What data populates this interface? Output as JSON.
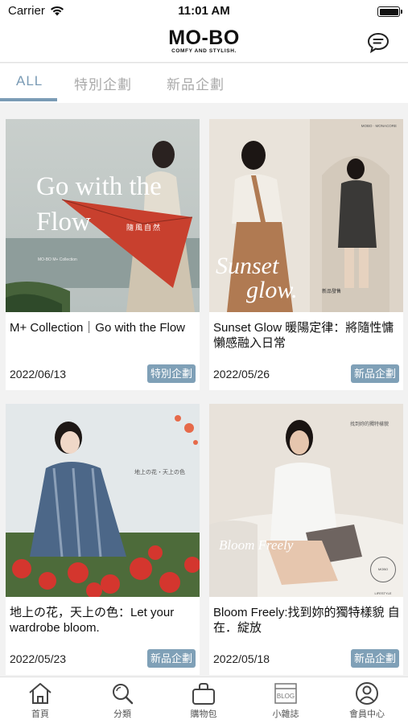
{
  "status_bar": {
    "carrier": "Carrier",
    "time": "11:01 AM"
  },
  "header": {
    "logo_main": "MO-BO",
    "logo_sub": "COMFY AND STYLISH."
  },
  "tabs": [
    {
      "label": "ALL",
      "active": true
    },
    {
      "label": "特別企劃",
      "active": false
    },
    {
      "label": "新品企劃",
      "active": false
    }
  ],
  "cards": [
    {
      "title": "M+ Collection｜Go with the Flow",
      "date": "2022/06/13",
      "badge": "特別企劃",
      "image": {
        "title_line1": "Go with the",
        "title_line2": "Flow",
        "subtitle": "隨風自然",
        "caption": "MO-BO M+ Collection"
      }
    },
    {
      "title": "Sunset Glow 暖陽定律：將隨性慵懶感融入日常",
      "date": "2022/05/26",
      "badge": "新品企劃",
      "image": {
        "title_line1": "Sunset",
        "title_line2": "glow.",
        "top_right": "MOBO · MONACORE",
        "caption_label": "新品發售"
      }
    },
    {
      "title": "地上の花，天上の色：Let your wardrobe bloom.",
      "date": "2022/05/23",
      "badge": "新品企劃",
      "image": {
        "vertical_text": "地上の花・天上の色"
      }
    },
    {
      "title": "Bloom Freely:找到妳的獨特樣貌 自在．綻放",
      "date": "2022/05/18",
      "badge": "新品企劃",
      "image": {
        "script_title": "Bloom Freely",
        "vertical_text": "找到妳的獨特樣貌",
        "seal_text": "MOBO LIFESTYLE"
      }
    }
  ],
  "bottom_nav": [
    {
      "label": "首頁",
      "icon": "home-icon"
    },
    {
      "label": "分類",
      "icon": "search-icon"
    },
    {
      "label": "購物包",
      "icon": "bag-icon"
    },
    {
      "label": "小雜誌",
      "icon": "blog-icon",
      "icon_text": "BLOG"
    },
    {
      "label": "會員中心",
      "icon": "user-icon"
    }
  ],
  "colors": {
    "accent": "#7a9bb5",
    "badge": "#7fa0b7",
    "background": "#f2f2f2"
  }
}
